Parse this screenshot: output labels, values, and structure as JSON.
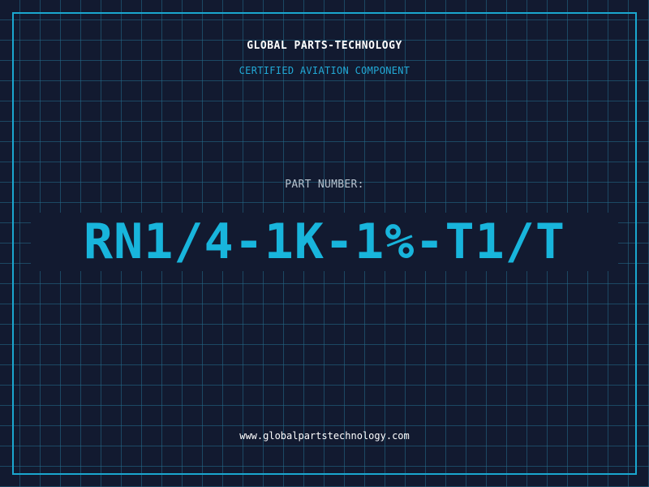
{
  "header": {
    "company": "GLOBAL PARTS-TECHNOLOGY",
    "tagline": "CERTIFIED AVIATION COMPONENT"
  },
  "part": {
    "label": "PART NUMBER:",
    "number": "RN1/4-1K-1%-T1/T"
  },
  "footer": {
    "url": "www.globalpartstechnology.com"
  },
  "colors": {
    "background": "#121a30",
    "grid": "#246e8c",
    "accent": "#18b5dc",
    "text": "#ffffff",
    "muted": "#b7c3cf"
  }
}
